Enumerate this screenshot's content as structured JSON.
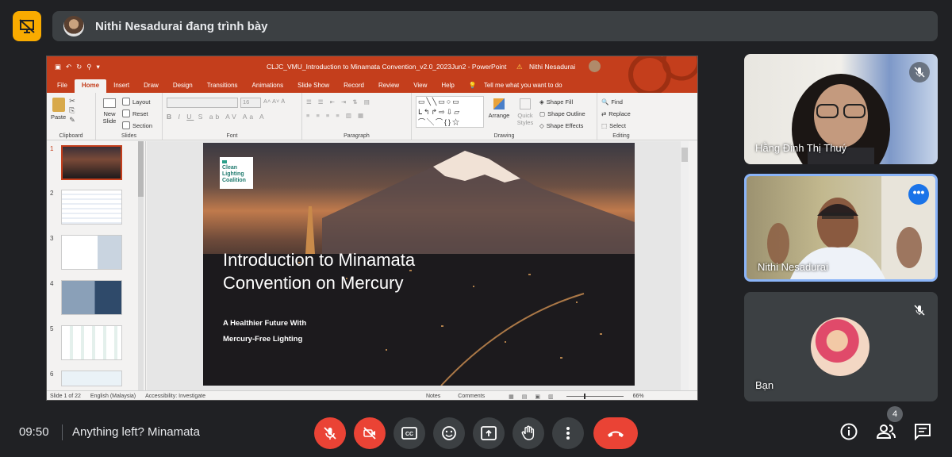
{
  "presenter_bar": {
    "text": "Nithi Nesadurai đang trình bày"
  },
  "ppt": {
    "title": "CLJC_VMU_Introduction to Minamata Convention_v2.0_2023Jun2 - PowerPoint",
    "user": "Nithi Nesadurai",
    "tabs": [
      "File",
      "Home",
      "Insert",
      "Draw",
      "Design",
      "Transitions",
      "Animations",
      "Slide Show",
      "Record",
      "Review",
      "View",
      "Help"
    ],
    "tell_me": "Tell me what you want to do",
    "ribbon": {
      "clipboard": "Clipboard",
      "paste": "Paste",
      "slides": "Slides",
      "new_slide": "New Slide",
      "layout": "Layout",
      "reset": "Reset",
      "section": "Section",
      "font": "Font",
      "font_size": "16",
      "paragraph": "Paragraph",
      "drawing": "Drawing",
      "arrange": "Arrange",
      "quick_styles": "Quick Styles",
      "shape_fill": "Shape Fill",
      "shape_outline": "Shape Outline",
      "shape_effects": "Shape Effects",
      "editing": "Editing",
      "find": "Find",
      "replace": "Replace",
      "select": "Select"
    },
    "thumb_numbers": [
      "1",
      "2",
      "3",
      "4",
      "5",
      "6"
    ],
    "slide": {
      "logo_l1": "Clean",
      "logo_l2": "Lighting",
      "logo_l3": "Coalition",
      "title_l1": "Introduction to Minamata",
      "title_l2": "Convention on Mercury",
      "sub_l1": "A Healthier Future With",
      "sub_l2": "Mercury-Free Lighting"
    },
    "status": {
      "slide_of": "Slide 1 of 22",
      "lang": "English (Malaysia)",
      "access": "Accessibility: Investigate",
      "notes": "Notes",
      "comments": "Comments",
      "zoom": "66%"
    }
  },
  "participants": [
    {
      "name": "Hằng Đinh Thị Thuý",
      "muted": true
    },
    {
      "name": "Nithi Nesadurai",
      "muted": false
    },
    {
      "name": "Bạn",
      "muted": true
    }
  ],
  "meeting": {
    "time": "09:50",
    "name": "Anything left? Minamata",
    "people_count": "4"
  },
  "colors": {
    "accent_red": "#ea4335",
    "present_yellow": "#f9ab00",
    "ppt_orange": "#c43e1c",
    "active_blue": "#8ab4f8"
  }
}
